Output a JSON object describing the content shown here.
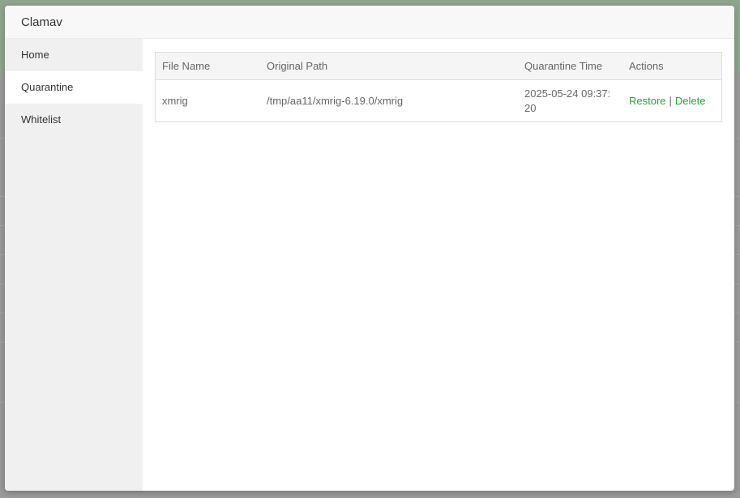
{
  "modal": {
    "title": "Clamav"
  },
  "sidebar": {
    "items": [
      {
        "label": "Home"
      },
      {
        "label": "Quarantine",
        "active": true
      },
      {
        "label": "Whitelist"
      }
    ]
  },
  "table": {
    "headers": [
      "File Name",
      "Original Path",
      "Quarantine Time",
      "Actions"
    ],
    "rows": [
      {
        "file_name": "xmrig",
        "original_path": "/tmp/aa11/xmrig-6.19.0/xmrig",
        "quarantine_time": "2025-05-24 09:37:20",
        "restore_label": "Restore",
        "separator": "|",
        "delete_label": "Delete"
      }
    ]
  },
  "colors": {
    "accent": "#20a53a",
    "sidebar_bg": "#f0f0f0",
    "header_bg": "#f8f8f8"
  }
}
